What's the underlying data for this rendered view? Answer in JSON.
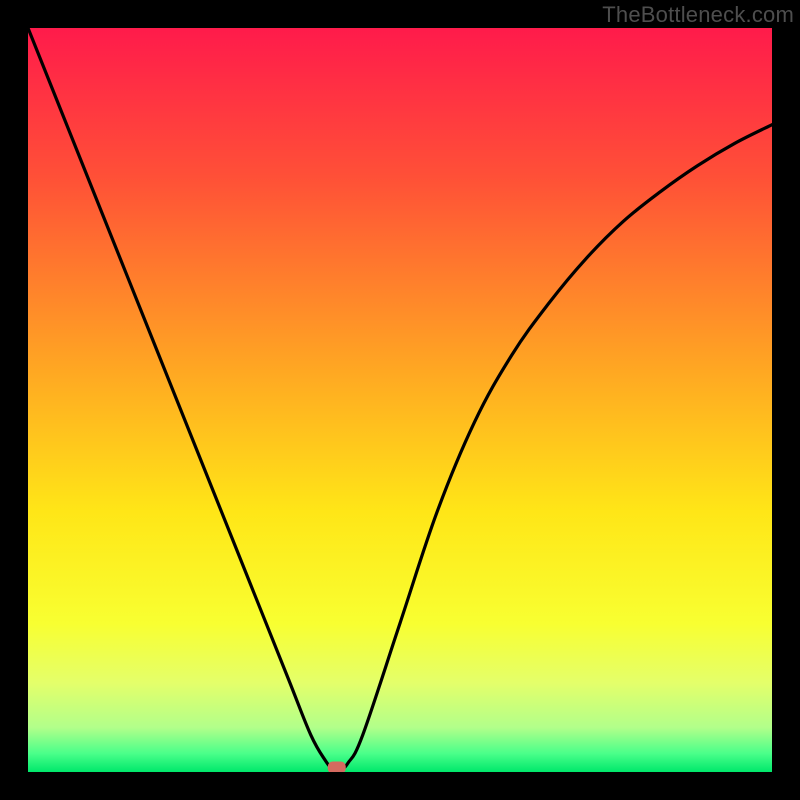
{
  "watermark": "TheBottleneck.com",
  "chart_data": {
    "type": "line",
    "title": "",
    "xlabel": "",
    "ylabel": "",
    "xlim": [
      0,
      100
    ],
    "ylim": [
      0,
      100
    ],
    "grid": false,
    "series": [
      {
        "name": "curve",
        "x": [
          0,
          5,
          10,
          15,
          20,
          25,
          30,
          35,
          38,
          40,
          41,
          42,
          43,
          45,
          50,
          55,
          60,
          65,
          70,
          75,
          80,
          85,
          90,
          95,
          100
        ],
        "y": [
          100,
          87.5,
          75,
          62.5,
          50,
          37.5,
          25,
          12.5,
          5,
          1.5,
          0.4,
          0.4,
          1.2,
          5,
          20,
          35,
          47,
          56,
          63,
          69,
          74,
          78,
          81.5,
          84.5,
          87
        ]
      }
    ],
    "marker": {
      "x": 41.5,
      "y": 0.6
    },
    "gradient_stops": [
      {
        "offset": 0,
        "color": "#ff1b4b"
      },
      {
        "offset": 0.2,
        "color": "#ff5037"
      },
      {
        "offset": 0.45,
        "color": "#ffa423"
      },
      {
        "offset": 0.65,
        "color": "#ffe617"
      },
      {
        "offset": 0.8,
        "color": "#f8ff31"
      },
      {
        "offset": 0.88,
        "color": "#e4ff6a"
      },
      {
        "offset": 0.94,
        "color": "#b2ff8a"
      },
      {
        "offset": 0.975,
        "color": "#4bff8a"
      },
      {
        "offset": 1.0,
        "color": "#00e86b"
      }
    ]
  }
}
